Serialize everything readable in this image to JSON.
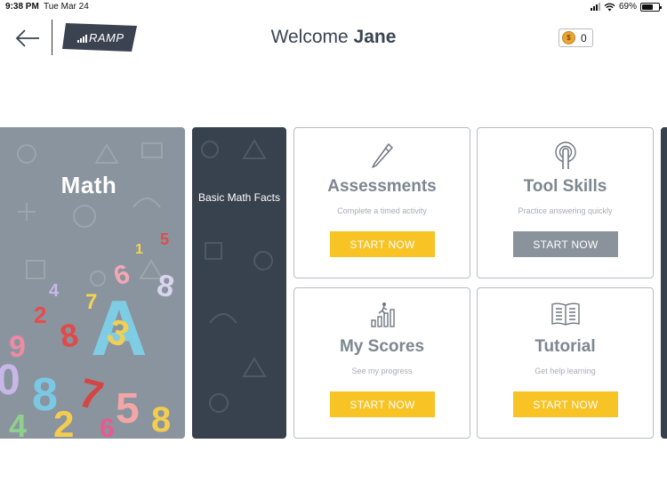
{
  "status": {
    "time": "9:38 PM",
    "date": "Tue Mar 24",
    "battery": "69%"
  },
  "header": {
    "logo_text": "RAMP",
    "welcome_prefix": "Welcome",
    "user_name": "Jane",
    "coins": "0"
  },
  "subject": {
    "title": "Math"
  },
  "topic": {
    "title": "Basic Math Facts"
  },
  "cards": [
    {
      "title": "Assessments",
      "subtitle": "Complete a timed activity",
      "button": "START NOW",
      "icon": "pencil-icon"
    },
    {
      "title": "Tool Skills",
      "subtitle": "Practice answering quickly",
      "button": "START NOW",
      "icon": "touch-finger-icon"
    },
    {
      "title": "My Scores",
      "subtitle": "See my progress",
      "button": "START NOW",
      "icon": "progress-chart-icon"
    },
    {
      "title": "Tutorial",
      "subtitle": "Get help learning",
      "button": "START NOW",
      "icon": "book-icon"
    }
  ],
  "colors": {
    "accent_yellow": "#f7c325",
    "button_gray": "#8a929b",
    "dark_panel": "#38414e",
    "subject_panel": "#8a949e",
    "card_title": "#7d8791"
  }
}
